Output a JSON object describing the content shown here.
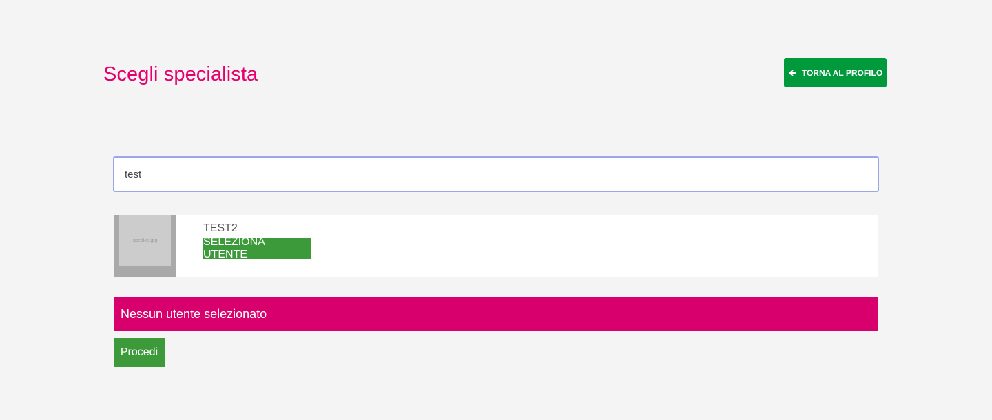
{
  "header": {
    "title": "Scegli specialista",
    "back_button_label": "TORNA AL PROFILO",
    "back_icon": "arrow-left-icon"
  },
  "search": {
    "value": "test"
  },
  "results": [
    {
      "name": "TEST2",
      "avatar_text": "speaker.jpg",
      "select_label": "SELEZIONA UTENTE"
    }
  ],
  "status": {
    "message": "Nessun utente selezionato"
  },
  "actions": {
    "proceed_label": "Procedi"
  },
  "colors": {
    "title": "#e6006e",
    "back_button": "#009a3c",
    "action_green": "#3d9a3a",
    "status_bar": "#d8006c",
    "input_border": "#9aa7ea"
  }
}
